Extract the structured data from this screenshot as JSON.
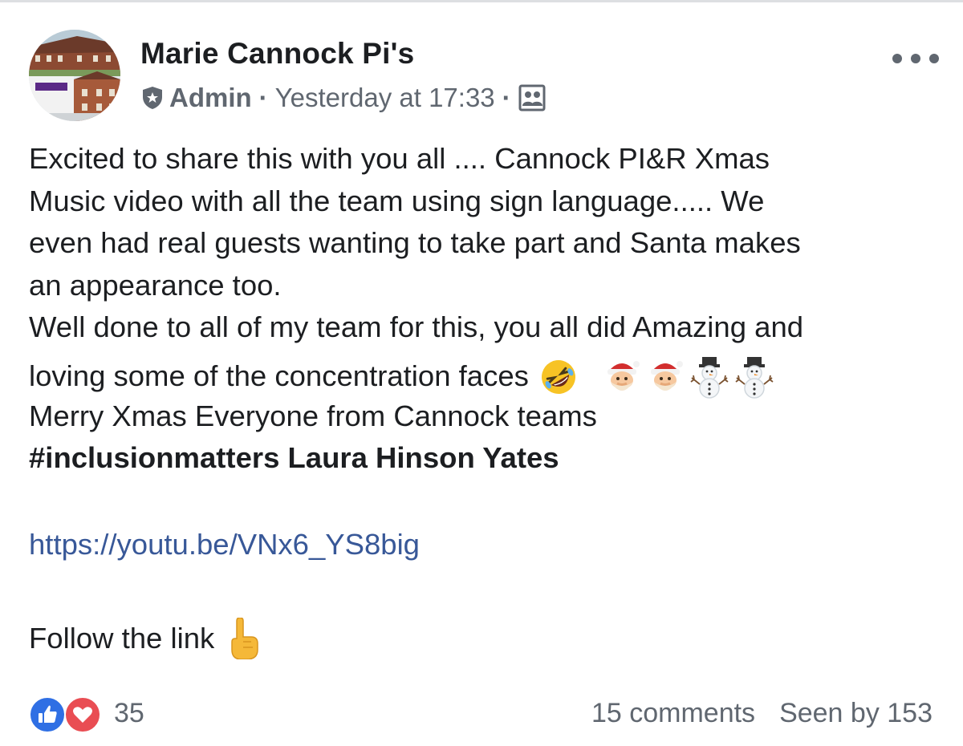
{
  "post": {
    "author": "Marie Cannock Pi's",
    "role": "Admin",
    "separator": "·",
    "time": "Yesterday at 17:33",
    "body_lines": [
      "Excited to share this with you all .... Cannock PI&R Xmas",
      "Music video with all the team using sign language..... We",
      "even had real guests wanting to take part and Santa makes",
      "an appearance too.",
      "Well done to all of my team for this, you all did Amazing and",
      "loving some of the concentration faces",
      "Merry Xmas Everyone from Cannock teams"
    ],
    "bold_line": "#inclusionmatters Laura Hinson Yates",
    "link": "https://youtu.be/VNx6_YS8big",
    "follow": "Follow the link"
  },
  "footer": {
    "reaction_count": "35",
    "comments": "15 comments",
    "seen_by": "Seen by 153"
  },
  "icons": {
    "admin": "shield-star-icon",
    "audience": "group-icon",
    "more": "more-options-icon",
    "emoji_laughing": "rolling-on-floor-laughing-icon",
    "emoji_santa": "santa-icon",
    "emoji_snowman": "snowman-icon",
    "emoji_pointing": "pointing-up-icon",
    "like": "like-reaction-icon",
    "love": "love-reaction-icon"
  },
  "colors": {
    "link": "#385898",
    "secondary_text": "#606770",
    "like": "#2f6fe4",
    "love": "#e94d53"
  }
}
